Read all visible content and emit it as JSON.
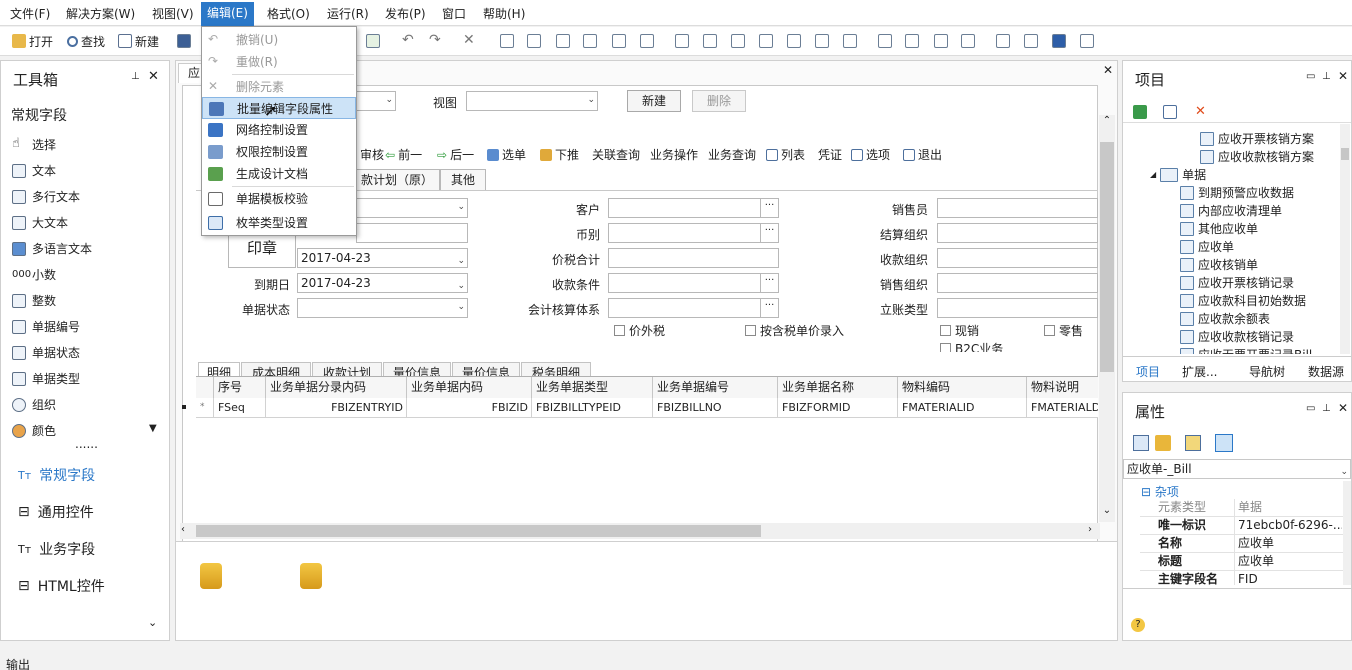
{
  "menu": [
    "文件(F)",
    "解决方案(W)",
    "视图(V)",
    "编辑(E)",
    "格式(O)",
    "运行(R)",
    "发布(P)",
    "窗口",
    "帮助(H)"
  ],
  "toolbar": {
    "open": "打开",
    "find": "查找",
    "new": "新建"
  },
  "edit_menu": {
    "items": [
      "撤销(U)",
      "重做(R)",
      "删除元素",
      "批量编辑字段属性",
      "网络控制设置",
      "权限控制设置",
      "生成设计文档",
      "单据模板校验",
      "枚举类型设置"
    ]
  },
  "toolbox": {
    "title": "工具箱",
    "section": "常规字段",
    "items": [
      "选择",
      "文本",
      "多行文本",
      "大文本",
      "多语言文本",
      "小数",
      "整数",
      "单据编号",
      "单据状态",
      "单据类型",
      "组织",
      "颜色"
    ],
    "more": "......",
    "categories": [
      "常规字段",
      "通用控件",
      "业务字段",
      "HTML控件"
    ]
  },
  "doc": {
    "tab_partial": "应",
    "view_label": "视图",
    "new_btn": "新建",
    "delete_btn": "删除",
    "form_toolbar": [
      "审核",
      "前一",
      "后一",
      "选单",
      "下推",
      "关联查询",
      "业务操作",
      "业务查询",
      "列表",
      "凭证",
      "选项",
      "退出"
    ],
    "top_tabs": [
      "款计划（原）",
      "其他"
    ],
    "print_label": "印章",
    "fields": {
      "date1": "2017-04-23",
      "due_label": "到期日",
      "due_value": "2017-04-23",
      "status_label": "单据状态",
      "customer": "客户",
      "currency": "币别",
      "total": "价税合计",
      "terms": "收款条件",
      "acct": "会计核算体系",
      "sales": "销售员",
      "settle": "结算组织",
      "recv_org": "收款组织",
      "sale_org": "销售组织",
      "acct_type": "立账类型",
      "cb_tax": "价外税",
      "cb_taxprice": "按含税单价录入",
      "cb_cash": "现销",
      "cb_retail": "零售",
      "cb_b2c": "B2C业务"
    },
    "bottom_tabs": [
      "明细",
      "成本明细",
      "收款计划",
      "量价信息",
      "量价信息",
      "税务明细"
    ],
    "grid": {
      "headers": [
        "序号",
        "业务单据分录内码",
        "业务单据内码",
        "业务单据类型",
        "业务单据编号",
        "业务单据名称",
        "物料编码",
        "物料说明"
      ],
      "row": [
        "FSeq",
        "FBIZENTRYID",
        "FBIZID",
        "FBIZBILLTYPEID",
        "FBIZBILLNO",
        "FBIZFORMID",
        "FMATERIALID",
        "FMATERIALD"
      ],
      "row_marker": "*"
    }
  },
  "project": {
    "title": "项目",
    "tree": [
      "应收开票核销方案",
      "应收收款核销方案",
      "单据",
      "到期预警应收数据",
      "内部应收清理单",
      "其他应收单",
      "应收单",
      "应收核销单",
      "应收开票核销记录",
      "应收款科目初始数据",
      "应收款余额表",
      "应收收款核销记录",
      "应收无票开票记录Bill"
    ],
    "tabs": [
      "项目",
      "扩展...",
      "导航树",
      "数据源"
    ]
  },
  "props": {
    "title": "属性",
    "object": "应收单-_Bill",
    "group": "杂项",
    "rows": [
      [
        "元素类型",
        "单据"
      ],
      [
        "唯一标识",
        "71ebcb0f-6296-..."
      ],
      [
        "名称",
        "应收单"
      ],
      [
        "标题",
        "应收单"
      ],
      [
        "主键字段名",
        "FID"
      ]
    ]
  },
  "output": "输出",
  "colors": {
    "accent": "#2b78c8",
    "highlight": "#cde3f7"
  }
}
